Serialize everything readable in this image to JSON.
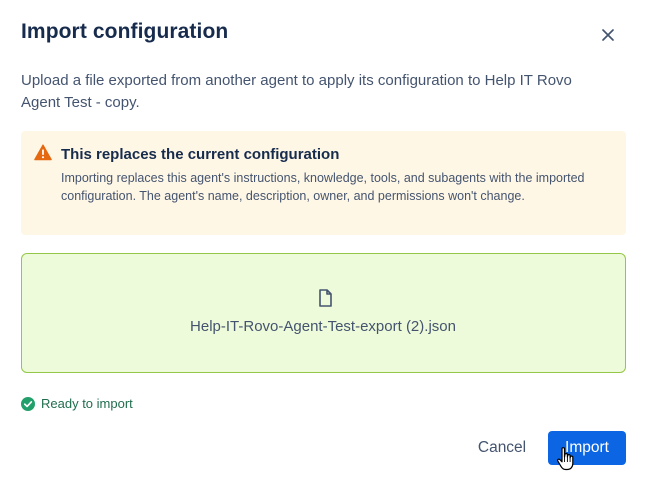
{
  "dialog": {
    "title": "Import configuration",
    "close_icon": "close-icon",
    "description": "Upload a file exported from another agent to apply its configuration to Help IT Rovo Agent Test - copy."
  },
  "warning": {
    "icon": "warning-icon",
    "title": "This replaces the current configuration",
    "body": "Importing replaces this agent's instructions, knowledge, tools, and subagents with the imported configuration. The agent's name, description, owner, and permissions won't change.",
    "colors": {
      "background": "#fff7e6",
      "icon": "#e56910"
    }
  },
  "dropzone": {
    "icon": "file-icon",
    "file_name": "Help-IT-Rovo-Agent-Test-export (2).json",
    "colors": {
      "background": "#eefbda",
      "border": "#94c748"
    }
  },
  "status": {
    "icon": "check-circle-icon",
    "text": "Ready to import",
    "color": "#216e4e"
  },
  "footer": {
    "cancel_label": "Cancel",
    "import_label": "Import",
    "accent": "#0c66e4"
  }
}
